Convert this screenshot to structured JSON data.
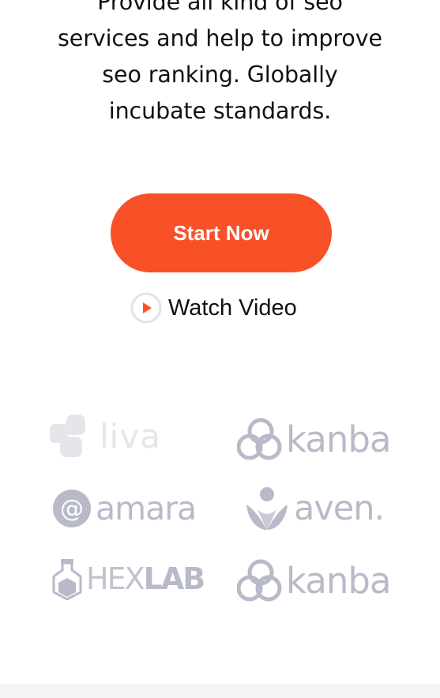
{
  "hero": {
    "lines": [
      "Provide all kind of seo",
      "services and help to improve",
      "seo ranking. Globally",
      "incubate standards."
    ]
  },
  "cta": {
    "label": "Start Now"
  },
  "watch_video": {
    "label": "Watch Video"
  },
  "partners": {
    "liva": "liva",
    "kanba_1": "kanba",
    "amara": "amara",
    "aven": "aven.",
    "hexlab_hex": "HEX",
    "hexlab_lab": "LAB",
    "kanba_2": "kanba"
  },
  "colors": {
    "accent": "#f85128",
    "logo_gray": "#b9bac9",
    "logo_light": "#e6e6ea",
    "text": "#111111"
  },
  "icons": {
    "watch_video": "play-icon"
  }
}
